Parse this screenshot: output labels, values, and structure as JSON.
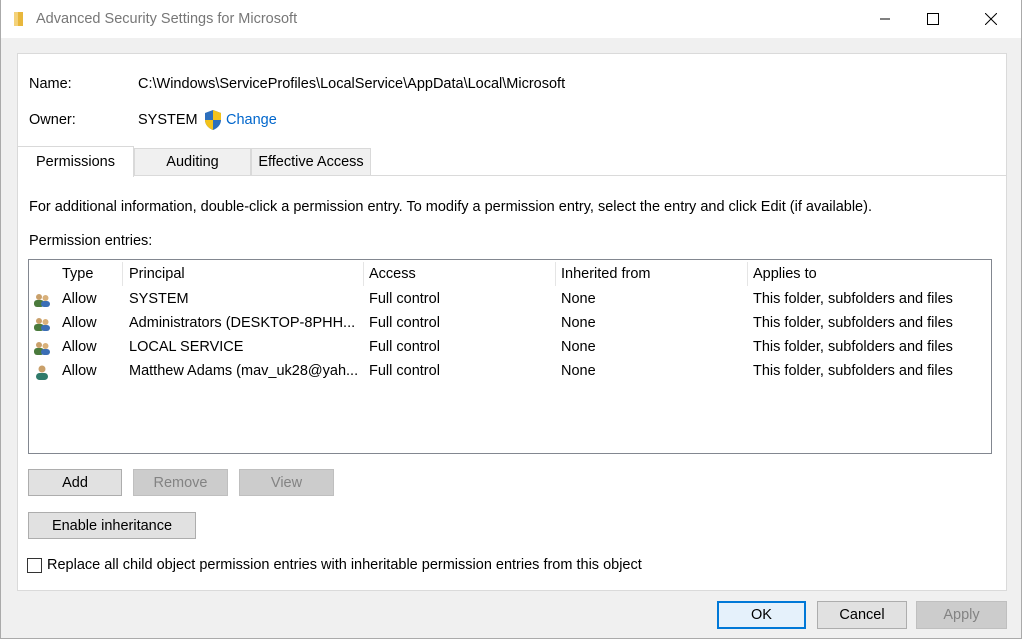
{
  "window": {
    "title": "Advanced Security Settings for Microsoft"
  },
  "object": {
    "name_label": "Name:",
    "name_value": "C:\\Windows\\ServiceProfiles\\LocalService\\AppData\\Local\\Microsoft",
    "owner_label": "Owner:",
    "owner_value": "SYSTEM",
    "change_label": "Change"
  },
  "tabs": [
    {
      "label": "Permissions",
      "active": true
    },
    {
      "label": "Auditing",
      "active": false
    },
    {
      "label": "Effective Access",
      "active": false
    }
  ],
  "permissions": {
    "info": "For additional information, double-click a permission entry. To modify a permission entry, select the entry and click Edit (if available).",
    "entries_label": "Permission entries:",
    "columns": [
      "Type",
      "Principal",
      "Access",
      "Inherited from",
      "Applies to"
    ],
    "rows": [
      {
        "icon": "group-users-icon",
        "type": "Allow",
        "principal": "SYSTEM",
        "access": "Full control",
        "inherited": "None",
        "applies": "This folder, subfolders and files"
      },
      {
        "icon": "group-users-icon",
        "type": "Allow",
        "principal": "Administrators (DESKTOP-8PHH...",
        "access": "Full control",
        "inherited": "None",
        "applies": "This folder, subfolders and files"
      },
      {
        "icon": "group-users-icon",
        "type": "Allow",
        "principal": "LOCAL SERVICE",
        "access": "Full control",
        "inherited": "None",
        "applies": "This folder, subfolders and files"
      },
      {
        "icon": "user-icon",
        "type": "Allow",
        "principal": "Matthew Adams (mav_uk28@yah...",
        "access": "Full control",
        "inherited": "None",
        "applies": "This folder, subfolders and files"
      }
    ]
  },
  "buttons": {
    "add": "Add",
    "remove": "Remove",
    "view": "View",
    "enable_inheritance": "Enable inheritance",
    "ok": "OK",
    "cancel": "Cancel",
    "apply": "Apply"
  },
  "replace_checkbox": {
    "label": "Replace all child object permission entries with inheritable permission entries from this object",
    "checked": false
  },
  "colors": {
    "link": "#0066cc",
    "focus_border": "#0078d7"
  }
}
